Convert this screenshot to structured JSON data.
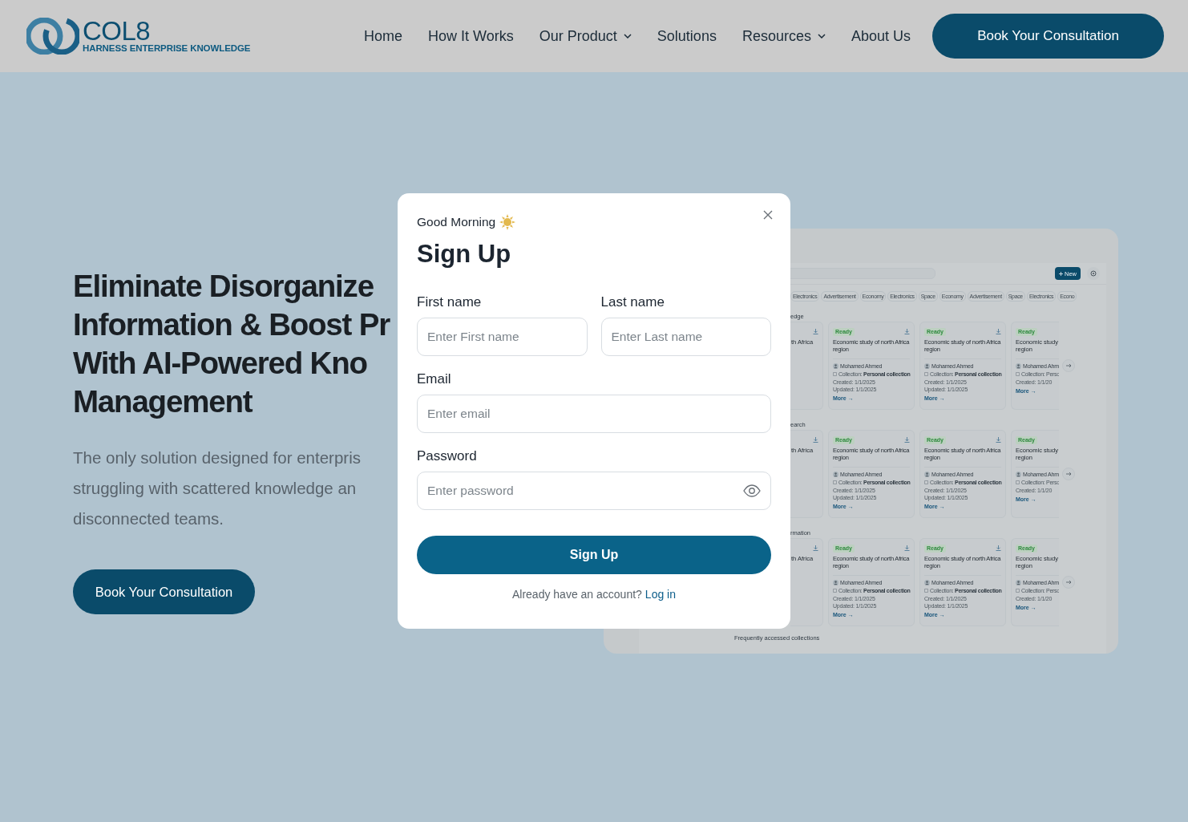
{
  "header": {
    "logo": {
      "name": "COL8",
      "tagline": "HARNESS ENTERPRISE KNOWLEDGE"
    },
    "nav": [
      {
        "label": "Home",
        "dropdown": false
      },
      {
        "label": "How It Works",
        "dropdown": false
      },
      {
        "label": "Our Product",
        "dropdown": true
      },
      {
        "label": "Solutions",
        "dropdown": false
      },
      {
        "label": "Resources",
        "dropdown": true
      },
      {
        "label": "About Us",
        "dropdown": false
      }
    ],
    "cta": "Book Your Consultation"
  },
  "hero": {
    "heading_lines": [
      "Eliminate Disorganize",
      "Information & Boost Pr",
      "With AI-Powered Kno",
      "Management"
    ],
    "text_lines": [
      "The only solution designed for enterpris",
      "struggling with scattered knowledge an",
      "disconnected teams."
    ],
    "cta": "Book Your Consultation"
  },
  "preview": {
    "new_button": "New",
    "chips": [
      "Electronics",
      "Advertisement",
      "Economy",
      "Electronics",
      "Space",
      "Economy",
      "Advertisement",
      "Space",
      "Electronics",
      "Econo"
    ],
    "sections": [
      {
        "title": "edge",
        "left_card_text": "th Africa",
        "cards": [
          {
            "status": "Ready",
            "title": "Economic study of north Africa region",
            "author": "Mohamed Ahmed",
            "collection": "Collection: **Personal collection**",
            "created": "Created: 1/1/2025",
            "updated": "Updated: 1/1/2025",
            "more": "More →"
          },
          {
            "status": "Ready",
            "title": "Economic study of north Africa region",
            "author": "Mohamed Ahmed",
            "collection": "Collection: **Personal collection**",
            "created": "Created: 1/1/2025",
            "updated": "Updated: 1/1/2025",
            "more": "More →"
          }
        ],
        "partial_card": {
          "status": "Ready",
          "title": "Economic study",
          "title_2": "region",
          "author": "Mohamed Ahm",
          "collection": "Collection: Perso",
          "created": "Created: 1/1/20",
          "more": "More →"
        }
      },
      {
        "title": "earch",
        "left_card_text": "th Africa",
        "cards": [
          {
            "status": "Ready",
            "title": "Economic study of north Africa region",
            "author": "Mohamed Ahmed",
            "collection": "Collection: **Personal collection**",
            "created": "Created: 1/1/2025",
            "updated": "Updated: 1/1/2025",
            "more": "More →"
          },
          {
            "status": "Ready",
            "title": "Economic study of north Africa region",
            "author": "Mohamed Ahmed",
            "collection": "Collection: **Personal collection**",
            "created": "Created: 1/1/2025",
            "updated": "Updated: 1/1/2025",
            "more": "More →"
          }
        ],
        "partial_card": {
          "status": "Ready",
          "title": "Economic study",
          "title_2": "region",
          "author": "Mohamed Ahm",
          "collection": "Collection: Perso",
          "created": "Created: 1/1/20",
          "more": "More →"
        }
      },
      {
        "title": "rmation",
        "left_card_text": "th Africa",
        "cards": [
          {
            "status": "Ready",
            "title": "Economic study of north Africa region",
            "author": "Mohamed Ahmed",
            "collection": "Collection: **Personal collection**",
            "created": "Created: 1/1/2025",
            "updated": "Updated: 1/1/2025",
            "more": "More →"
          },
          {
            "status": "Ready",
            "title": "Economic study of north Africa region",
            "author": "Mohamed Ahmed",
            "collection": "Collection: **Personal collection**",
            "created": "Created: 1/1/2025",
            "updated": "Updated: 1/1/2025",
            "more": "More →"
          }
        ],
        "partial_card": {
          "status": "Ready",
          "title": "Economic study",
          "title_2": "region",
          "author": "Mohamed Ahm",
          "collection": "Collection: Perso",
          "created": "Created: 1/1/20",
          "more": "More →"
        }
      }
    ],
    "footer_title": "Frequently accessed collections"
  },
  "modal": {
    "greeting": "Good Morning",
    "title": "Sign Up",
    "field_rows": [
      [
        {
          "label": "First name",
          "placeholder": "Enter First name",
          "kind": "text"
        },
        {
          "label": "Last name",
          "placeholder": "Enter Last name",
          "kind": "text"
        }
      ],
      [
        {
          "label": "Email",
          "placeholder": "Enter email",
          "kind": "email"
        }
      ],
      [
        {
          "label": "Password",
          "placeholder": "Enter password",
          "kind": "password"
        }
      ]
    ],
    "submit": "Sign Up",
    "footer": {
      "text": "Already have an account?",
      "link": "Log in"
    }
  }
}
